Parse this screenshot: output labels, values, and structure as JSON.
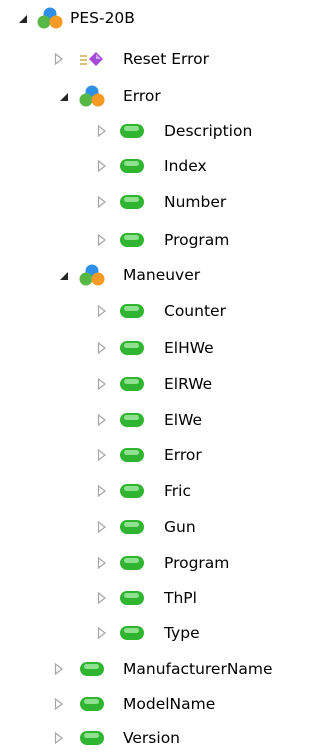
{
  "tree": {
    "root": {
      "label": "PES-20B",
      "icon": "namespace-icon",
      "expanded": true,
      "children": {
        "reset_error": {
          "label": "Reset Error",
          "icon": "method-icon"
        },
        "error": {
          "label": "Error",
          "icon": "namespace-icon",
          "expanded": true,
          "children": {
            "description": {
              "label": "Description",
              "icon": "property-icon"
            },
            "index": {
              "label": "Index",
              "icon": "property-icon"
            },
            "number": {
              "label": "Number",
              "icon": "property-icon"
            },
            "program": {
              "label": "Program",
              "icon": "property-icon"
            }
          }
        },
        "maneuver": {
          "label": "Maneuver",
          "icon": "namespace-icon",
          "expanded": true,
          "children": {
            "counter": {
              "label": "Counter",
              "icon": "property-icon"
            },
            "elhwe": {
              "label": "ElHWe",
              "icon": "property-icon"
            },
            "elrwe": {
              "label": "ElRWe",
              "icon": "property-icon"
            },
            "elwe": {
              "label": "ElWe",
              "icon": "property-icon"
            },
            "error": {
              "label": "Error",
              "icon": "property-icon"
            },
            "fric": {
              "label": "Fric",
              "icon": "property-icon"
            },
            "gun": {
              "label": "Gun",
              "icon": "property-icon"
            },
            "program": {
              "label": "Program",
              "icon": "property-icon"
            },
            "thpl": {
              "label": "ThPl",
              "icon": "property-icon"
            },
            "type": {
              "label": "Type",
              "icon": "property-icon"
            }
          }
        },
        "manufacturer_name": {
          "label": "ManufacturerName",
          "icon": "property-icon"
        },
        "model_name": {
          "label": "ModelName",
          "icon": "property-icon"
        },
        "version": {
          "label": "Version",
          "icon": "property-icon"
        }
      }
    }
  },
  "colors": {
    "arrow_collapsed": "#a6a6a6",
    "arrow_expanded": "#262626",
    "property_green": "#2fb52f",
    "property_green_light": "#8fe08f",
    "namespace_blue": "#2f8ee6",
    "namespace_orange": "#f59a23",
    "namespace_green": "#58b845",
    "method_purple": "#a34bd6",
    "method_lines": "#d7c37a"
  }
}
